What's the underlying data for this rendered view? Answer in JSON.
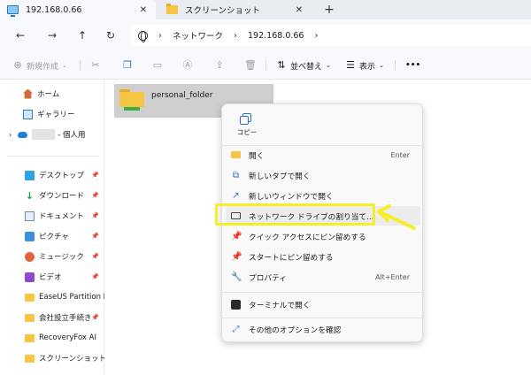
{
  "tabs": [
    {
      "label": "192.168.0.66",
      "icon": "monitor-icon"
    },
    {
      "label": "スクリーンショット",
      "icon": "folder-icon"
    }
  ],
  "tab_close_glyph": "✕",
  "new_tab_glyph": "+",
  "address": {
    "segments": [
      "ネットワーク",
      "192.168.0.66"
    ],
    "sep": "›"
  },
  "commands": {
    "new": "新規作成",
    "sort": "並べ替え",
    "view": "表示",
    "more": "•••"
  },
  "sidebar": {
    "top": [
      {
        "label": "ホーム",
        "icon": "home-icon"
      },
      {
        "label": "ギャラリー",
        "icon": "gallery-icon"
      },
      {
        "label": "- 個人用",
        "icon": "cloud-icon"
      }
    ],
    "pinned": [
      {
        "label": "デスクトップ",
        "icon": "desktop-icon"
      },
      {
        "label": "ダウンロード",
        "icon": "download-icon"
      },
      {
        "label": "ドキュメント",
        "icon": "document-icon"
      },
      {
        "label": "ピクチャ",
        "icon": "pictures-icon"
      },
      {
        "label": "ミュージック",
        "icon": "music-icon"
      },
      {
        "label": "ビデオ",
        "icon": "video-icon"
      }
    ],
    "folders": [
      {
        "label": "EaseUS Partition Ma",
        "icon": "folder-icon"
      },
      {
        "label": "会社設立手続き",
        "icon": "folder-icon"
      },
      {
        "label": "RecoveryFox AI",
        "icon": "folder-icon"
      },
      {
        "label": "スクリーンショット",
        "icon": "folder-icon"
      }
    ]
  },
  "file": {
    "name": "personal_folder"
  },
  "context_menu": {
    "copy_label": "コピー",
    "items": [
      {
        "label": "開く",
        "shortcut": "Enter",
        "icon": "folder-open-icon"
      },
      {
        "label": "新しいタブで開く",
        "shortcut": "",
        "icon": "new-tab-icon"
      },
      {
        "label": "新しいウィンドウで開く",
        "shortcut": "",
        "icon": "new-window-icon"
      },
      {
        "label": "ネットワーク ドライブの割り当て...",
        "shortcut": "",
        "icon": "map-drive-icon"
      },
      {
        "label": "クイック アクセスにピン留めする",
        "shortcut": "",
        "icon": "pin-icon"
      },
      {
        "label": "スタートにピン留めする",
        "shortcut": "",
        "icon": "pin-icon"
      },
      {
        "label": "プロパティ",
        "shortcut": "Alt+Enter",
        "icon": "wrench-icon"
      },
      {
        "label": "ターミナルで開く",
        "shortcut": "",
        "icon": "terminal-icon"
      },
      {
        "label": "その他のオプションを確認",
        "shortcut": "",
        "icon": "more-options-icon"
      }
    ]
  },
  "colors": {
    "highlight": "#f6ee2a",
    "accent": "#2c6ec7"
  }
}
